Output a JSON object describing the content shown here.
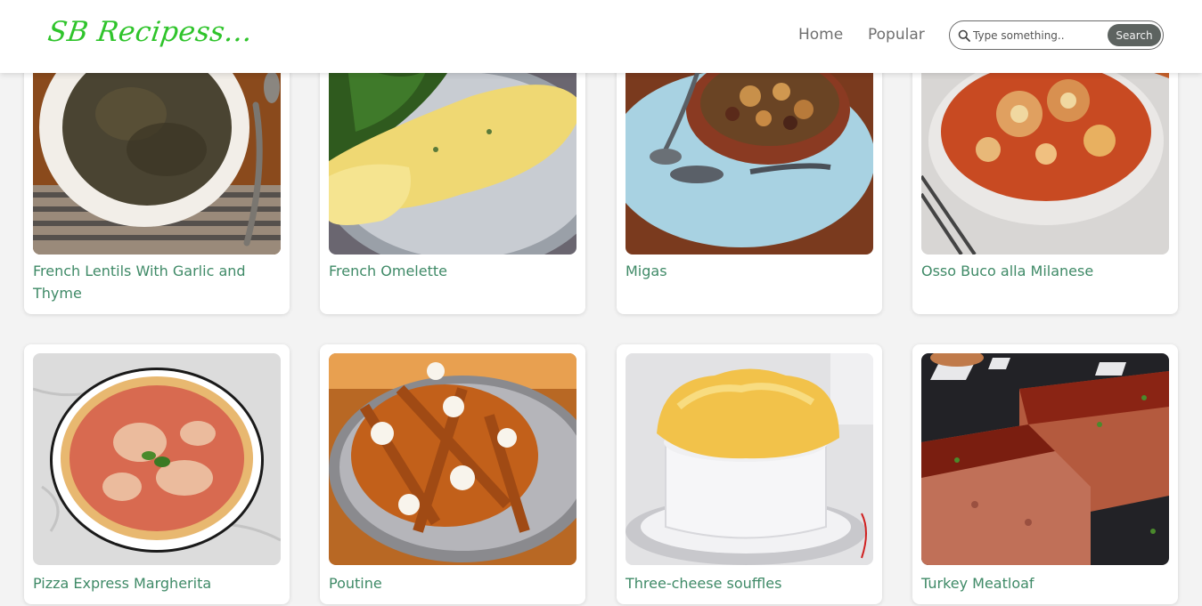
{
  "header": {
    "logo": "SB Recipess...",
    "nav": [
      {
        "label": "Home"
      },
      {
        "label": "Popular"
      }
    ],
    "search": {
      "placeholder": "Type something..",
      "value": "",
      "button_label": "Search"
    }
  },
  "recipes": [
    {
      "title": "French Lentils With Garlic and Thyme",
      "image_icon": "lentils-dish-image"
    },
    {
      "title": "French Omelette",
      "image_icon": "omelette-dish-image"
    },
    {
      "title": "Migas",
      "image_icon": "migas-dish-image"
    },
    {
      "title": "Osso Buco alla Milanese",
      "image_icon": "osso-buco-dish-image"
    },
    {
      "title": "Pizza Express Margherita",
      "image_icon": "pizza-dish-image"
    },
    {
      "title": "Poutine",
      "image_icon": "poutine-dish-image"
    },
    {
      "title": "Three-cheese souffles",
      "image_icon": "souffle-dish-image"
    },
    {
      "title": "Turkey Meatloaf",
      "image_icon": "meatloaf-dish-image"
    }
  ],
  "colors": {
    "brand": "#2fc42b",
    "recipe_title": "#3f8a67",
    "search_button": "#5d6360"
  }
}
